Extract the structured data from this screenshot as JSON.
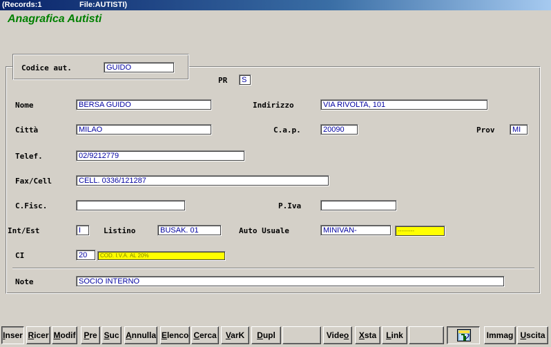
{
  "titlebar": {
    "records": "(Records:1",
    "file": "File:AUTISTI)"
  },
  "heading": "Anagrafica Autisti",
  "fields": {
    "codice": {
      "label": "Codice aut.",
      "value": "GUIDO"
    },
    "pr": {
      "label": "PR",
      "value": "S"
    },
    "nome": {
      "label": "Nome",
      "value": "BERSA GUIDO"
    },
    "indirizzo": {
      "label": "Indirizzo",
      "value": "VIA RIVOLTA, 101"
    },
    "citta": {
      "label": "Città",
      "value": "MILAO"
    },
    "cap": {
      "label": "C.a.p.",
      "value": "20090"
    },
    "prov": {
      "label": "Prov",
      "value": "MI"
    },
    "telef": {
      "label": "Telef.",
      "value": "02/9212779"
    },
    "faxcell": {
      "label": "Fax/Cell",
      "value": "CELL. 0336/121287"
    },
    "cfisc": {
      "label": "C.Fisc.",
      "value": ""
    },
    "piva": {
      "label": "P.Iva",
      "value": ""
    },
    "intest": {
      "label": "Int/Est",
      "value": "I"
    },
    "listino": {
      "label": "Listino",
      "value": "BUSAK. 01"
    },
    "auto": {
      "label": "Auto Usuale",
      "value": "MINIVAN-",
      "desc": "---------"
    },
    "ci": {
      "label": "CI",
      "value": "20",
      "desc": "COD. I.V.A. AL 20%"
    },
    "note": {
      "label": "Note",
      "value": "SOCIO INTERNO"
    }
  },
  "toolbar": {
    "inser": {
      "first": "I",
      "rest": "nser"
    },
    "ricer": {
      "first": "R",
      "rest": "icer"
    },
    "modif": {
      "first": "M",
      "rest": "odif"
    },
    "pre": {
      "first": "P",
      "rest": "re"
    },
    "suc": {
      "first": "S",
      "rest": "uc"
    },
    "annulla": {
      "first": "A",
      "rest": "nnulla"
    },
    "elenco": {
      "first": "E",
      "rest": "lenco"
    },
    "cerca": {
      "first": "C",
      "rest": "erca"
    },
    "vark": {
      "first": "V",
      "rest": "arK"
    },
    "dupl": {
      "first": "D",
      "rest": "upl"
    },
    "video": {
      "first": "Vide",
      "u": "o"
    },
    "xsta": {
      "first": "X",
      "rest": "sta"
    },
    "link": {
      "first": "L",
      "rest": "ink"
    },
    "immag": {
      "first": "Immag",
      "rest": ""
    },
    "uscita": {
      "first": "U",
      "rest": "scita"
    }
  }
}
